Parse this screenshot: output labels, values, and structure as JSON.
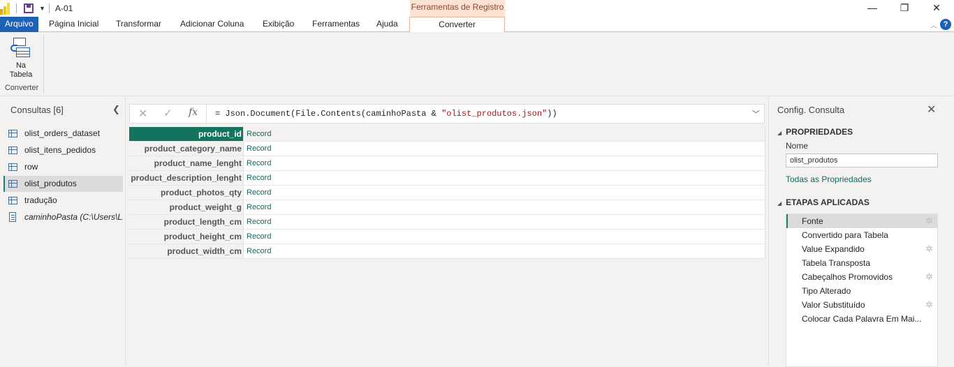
{
  "titlebar": {
    "doc_title": "A-01",
    "context_group": "Ferramentas de Registro",
    "minimize": "—",
    "restore": "❐",
    "close": "✕"
  },
  "tabs": [
    {
      "label": "Arquivo"
    },
    {
      "label": "Página Inicial"
    },
    {
      "label": "Transformar"
    },
    {
      "label": "Adicionar Coluna"
    },
    {
      "label": "Exibição"
    },
    {
      "label": "Ferramentas"
    },
    {
      "label": "Ajuda"
    },
    {
      "label": "Converter"
    }
  ],
  "ribbon": {
    "button_line1": "Na",
    "button_line2": "Tabela",
    "group_label": "Converter"
  },
  "queries": {
    "title": "Consultas [6]",
    "items": [
      {
        "label": "olist_orders_dataset"
      },
      {
        "label": "olist_itens_pedidos"
      },
      {
        "label": "row"
      },
      {
        "label": "olist_produtos"
      },
      {
        "label": "tradução"
      },
      {
        "label": "caminhoPasta (C:\\Users\\L..."
      }
    ]
  },
  "formula": {
    "prefix": "= Json.Document(File.Contents(caminhoPasta & ",
    "string": "\"olist_produtos.json\"",
    "suffix": "))"
  },
  "grid": {
    "rows": [
      {
        "key": "product_id",
        "value": "Record"
      },
      {
        "key": "product_category_name",
        "value": "Record"
      },
      {
        "key": "product_name_lenght",
        "value": "Record"
      },
      {
        "key": "product_description_lenght",
        "value": "Record"
      },
      {
        "key": "product_photos_qty",
        "value": "Record"
      },
      {
        "key": "product_weight_g",
        "value": "Record"
      },
      {
        "key": "product_length_cm",
        "value": "Record"
      },
      {
        "key": "product_height_cm",
        "value": "Record"
      },
      {
        "key": "product_width_cm",
        "value": "Record"
      }
    ]
  },
  "settings": {
    "title": "Config. Consulta",
    "properties_header": "PROPRIEDADES",
    "name_label": "Nome",
    "name_value": "olist_produtos",
    "all_properties_link": "Todas as Propriedades",
    "steps_header": "ETAPAS APLICADAS",
    "steps": [
      {
        "label": "Fonte",
        "gear": true
      },
      {
        "label": "Convertido para Tabela",
        "gear": false
      },
      {
        "label": "Value Expandido",
        "gear": true
      },
      {
        "label": "Tabela Transposta",
        "gear": false
      },
      {
        "label": "Cabeçalhos Promovidos",
        "gear": true
      },
      {
        "label": "Tipo Alterado",
        "gear": false
      },
      {
        "label": "Valor Substituído",
        "gear": true
      },
      {
        "label": "Colocar Cada Palavra Em Mai...",
        "gear": false
      }
    ]
  }
}
